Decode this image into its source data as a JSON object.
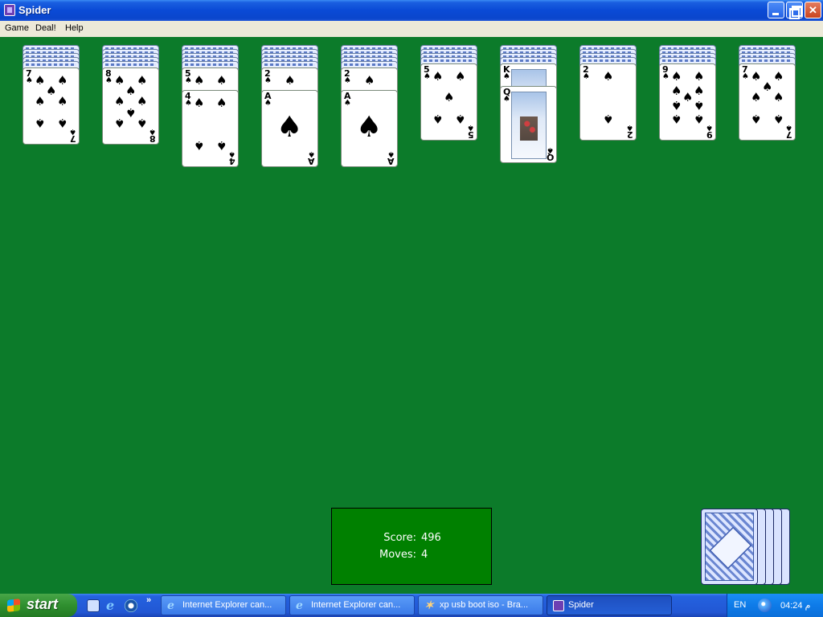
{
  "window": {
    "title": "Spider",
    "icons": {
      "app": "spider-cards-icon",
      "minimize": "minimize-icon",
      "maximize": "restore-icon",
      "close": "close-icon"
    }
  },
  "menu": [
    "Game",
    "Deal!",
    "Help"
  ],
  "game": {
    "suit_symbol": "♠",
    "columns": [
      {
        "hidden": 5,
        "cards": [
          {
            "rank": "7",
            "full": true
          }
        ]
      },
      {
        "hidden": 5,
        "cards": [
          {
            "rank": "8",
            "full": true
          }
        ]
      },
      {
        "hidden": 5,
        "cards": [
          {
            "rank": "5",
            "full": false
          },
          {
            "rank": "4",
            "full": true
          }
        ]
      },
      {
        "hidden": 5,
        "cards": [
          {
            "rank": "2",
            "full": false
          },
          {
            "rank": "A",
            "full": true
          }
        ]
      },
      {
        "hidden": 5,
        "cards": [
          {
            "rank": "2",
            "full": false
          },
          {
            "rank": "A",
            "full": true
          }
        ]
      },
      {
        "hidden": 4,
        "cards": [
          {
            "rank": "5",
            "full": true
          }
        ]
      },
      {
        "hidden": 4,
        "cards": [
          {
            "rank": "K",
            "full": false,
            "face": true
          },
          {
            "rank": "Q",
            "full": true,
            "face": true
          }
        ]
      },
      {
        "hidden": 4,
        "cards": [
          {
            "rank": "2",
            "full": true
          }
        ]
      },
      {
        "hidden": 4,
        "cards": [
          {
            "rank": "9",
            "full": true
          }
        ]
      },
      {
        "hidden": 4,
        "cards": [
          {
            "rank": "7",
            "full": true
          }
        ]
      }
    ],
    "stock_piles": 5
  },
  "score": {
    "score_label": "Score:",
    "score_value": "496",
    "moves_label": "Moves:",
    "moves_value": "4"
  },
  "taskbar": {
    "start_label": "start",
    "quicklaunch": [
      "show-desktop-icon",
      "internet-explorer-icon",
      "media-player-icon"
    ],
    "more": "»",
    "buttons": [
      {
        "label": "Internet Explorer can...",
        "icon": "internet-explorer-icon",
        "active": false
      },
      {
        "label": "Internet Explorer can...",
        "icon": "internet-explorer-icon",
        "active": false
      },
      {
        "label": "xp usb boot iso - Bra...",
        "icon": "browser-icon",
        "active": false
      },
      {
        "label": "Spider",
        "icon": "spider-cards-icon",
        "active": true
      }
    ],
    "language": "EN",
    "clock": "04:24 م"
  }
}
